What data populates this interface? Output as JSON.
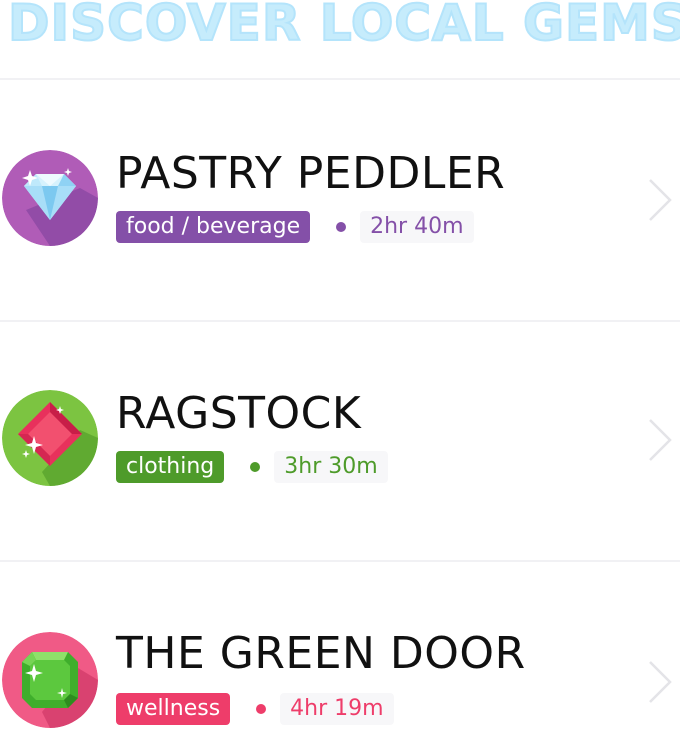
{
  "header": {
    "title": "DISCOVER LOCAL GEMS"
  },
  "places": [
    {
      "name": "PASTRY PEDDLER",
      "category": "food / beverage",
      "duration": "2hr 40m",
      "gem_icon": "diamond-gem-icon",
      "accent": "#8450a8"
    },
    {
      "name": "RAGSTOCK",
      "category": "clothing",
      "duration": "3hr 30m",
      "gem_icon": "ruby-gem-icon",
      "accent": "#4e9b2a"
    },
    {
      "name": "THE GREEN DOOR",
      "category": "wellness",
      "duration": "4hr 19m",
      "gem_icon": "emerald-gem-icon",
      "accent": "#ee3d6a"
    }
  ]
}
